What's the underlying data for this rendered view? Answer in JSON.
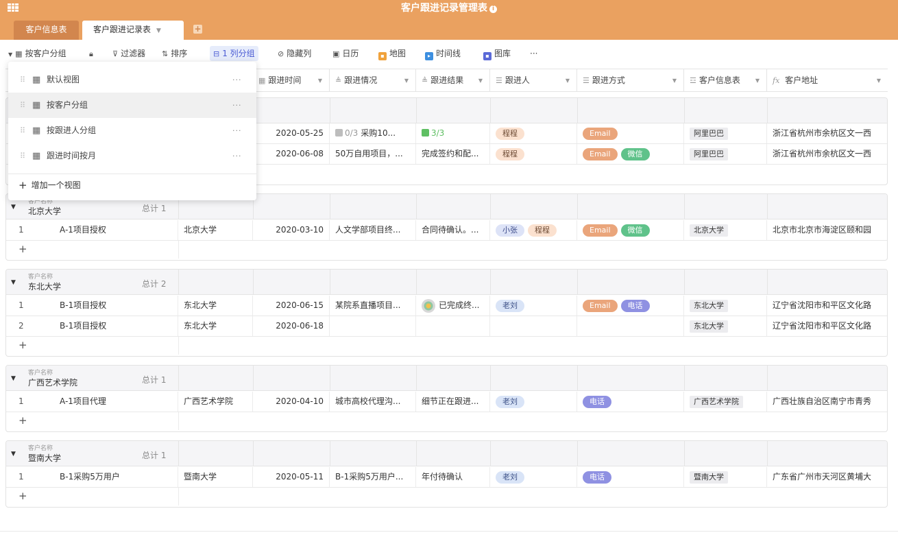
{
  "app": {
    "title": "客户跟进记录管理表",
    "info_icon": "i"
  },
  "tabs": [
    {
      "label": "客户信息表"
    },
    {
      "label": "客户跟进记录表"
    }
  ],
  "toolbar": {
    "view": "按客户分组",
    "filter": "过滤器",
    "sort": "排序",
    "group": "1 列分组",
    "hide": "隐藏列",
    "calendar": "日历",
    "map": "地图",
    "timeline": "时间线",
    "gallery": "图库",
    "more": "···"
  },
  "columns": {
    "time": "跟进时间",
    "situation": "跟进情况",
    "result": "跟进结果",
    "person": "跟进人",
    "method": "跟进方式",
    "customer_info": "客户信息表",
    "address": "客户地址",
    "formula_icon": "fx"
  },
  "menu": {
    "views": [
      "默认视图",
      "按客户分组",
      "按跟进人分组",
      "跟进时间按月"
    ],
    "more": "···",
    "add": "增加一个视图"
  },
  "group_label": "客户名称",
  "total_prefix": "总计",
  "groups": [
    {
      "name": "",
      "rows": [
        {
          "time": "2020-05-25",
          "situation_progress": "0/3",
          "situation": "采购10...",
          "result_progress": "3/3",
          "result": "",
          "persons": [
            "程程"
          ],
          "methods": [
            "Email"
          ],
          "customer": "阿里巴巴",
          "address": "浙江省杭州市余杭区文一西"
        },
        {
          "time": "2020-06-08",
          "situation": "50万自用项目，...",
          "result": "完成签约和配...",
          "persons": [
            "程程"
          ],
          "methods": [
            "Email",
            "微信"
          ],
          "customer": "阿里巴巴",
          "address": "浙江省杭州市余杭区文一西"
        }
      ]
    },
    {
      "name": "北京大学",
      "total": "1",
      "rows": [
        {
          "idx": "1",
          "title": "A-1项目授权",
          "customer_name": "北京大学",
          "time": "2020-03-10",
          "situation": "人文学部项目终...",
          "result": "合同待确认。...",
          "persons": [
            "小张",
            "程程"
          ],
          "methods": [
            "Email",
            "微信"
          ],
          "customer": "北京大学",
          "address": "北京市北京市海淀区颐和园"
        }
      ]
    },
    {
      "name": "东北大学",
      "total": "2",
      "rows": [
        {
          "idx": "1",
          "title": "B-1项目授权",
          "customer_name": "东北大学",
          "time": "2020-06-15",
          "situation": "某院系直播项目...",
          "result": "已完成终...",
          "persons": [
            "老刘"
          ],
          "methods": [
            "Email",
            "电话"
          ],
          "customer": "东北大学",
          "address": "辽宁省沈阳市和平区文化路"
        },
        {
          "idx": "2",
          "title": "B-1项目授权",
          "customer_name": "东北大学",
          "time": "2020-06-18",
          "situation": "",
          "result": "",
          "persons": [],
          "methods": [],
          "customer": "东北大学",
          "address": "辽宁省沈阳市和平区文化路"
        }
      ]
    },
    {
      "name": "广西艺术学院",
      "total": "1",
      "rows": [
        {
          "idx": "1",
          "title": "A-1项目代理",
          "customer_name": "广西艺术学院",
          "time": "2020-04-10",
          "situation": "城市高校代理沟...",
          "result": "细节正在跟进...",
          "persons": [
            "老刘"
          ],
          "methods": [
            "电话"
          ],
          "customer": "广西艺术学院",
          "address": "广西壮族自治区南宁市青秀"
        }
      ]
    },
    {
      "name": "暨南大学",
      "total": "1",
      "rows": [
        {
          "idx": "1",
          "title": "B-1采购5万用户",
          "customer_name": "暨南大学",
          "time": "2020-05-11",
          "situation": "B-1采购5万用户...",
          "result": "年付待确认",
          "persons": [
            "老刘"
          ],
          "methods": [
            "电话"
          ],
          "customer": "暨南大学",
          "address": "广东省广州市天河区黄埔大"
        }
      ]
    }
  ],
  "colors": {
    "header": "#eaa160",
    "tab_inactive": "#d2864e",
    "email": "#eaa57b",
    "wechat": "#5fc28a",
    "phone": "#8f91e2"
  }
}
